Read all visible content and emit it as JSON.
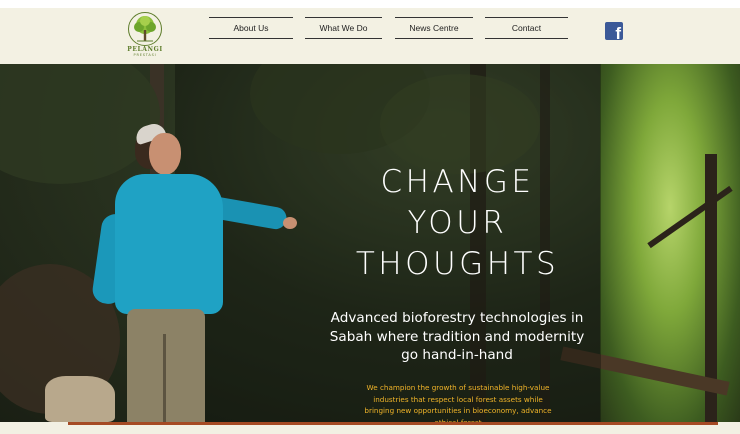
{
  "header": {
    "logo": {
      "name": "PELANGI",
      "sub": "PRESTASI"
    },
    "nav": [
      {
        "label": "About Us"
      },
      {
        "label": "What We Do"
      },
      {
        "label": "News Centre"
      },
      {
        "label": "Contact"
      }
    ],
    "social": {
      "icon": "facebook-icon",
      "glyph": "f",
      "color": "#3b5998"
    }
  },
  "hero": {
    "headline": [
      "CHANGE",
      "YOUR",
      "THOUGHTS"
    ],
    "subhead": "Advanced bioforestry technologies in Sabah where tradition and modernity go hand-in-hand",
    "body": "We champion the growth of sustainable high-value industries that respect local forest assets while bringing new opportunities in bioeconomy, advance ethical forest"
  },
  "colors": {
    "header_bg": "#f3f1e3",
    "accent_text": "#f0b429",
    "logo_green": "#5e7d2c"
  }
}
